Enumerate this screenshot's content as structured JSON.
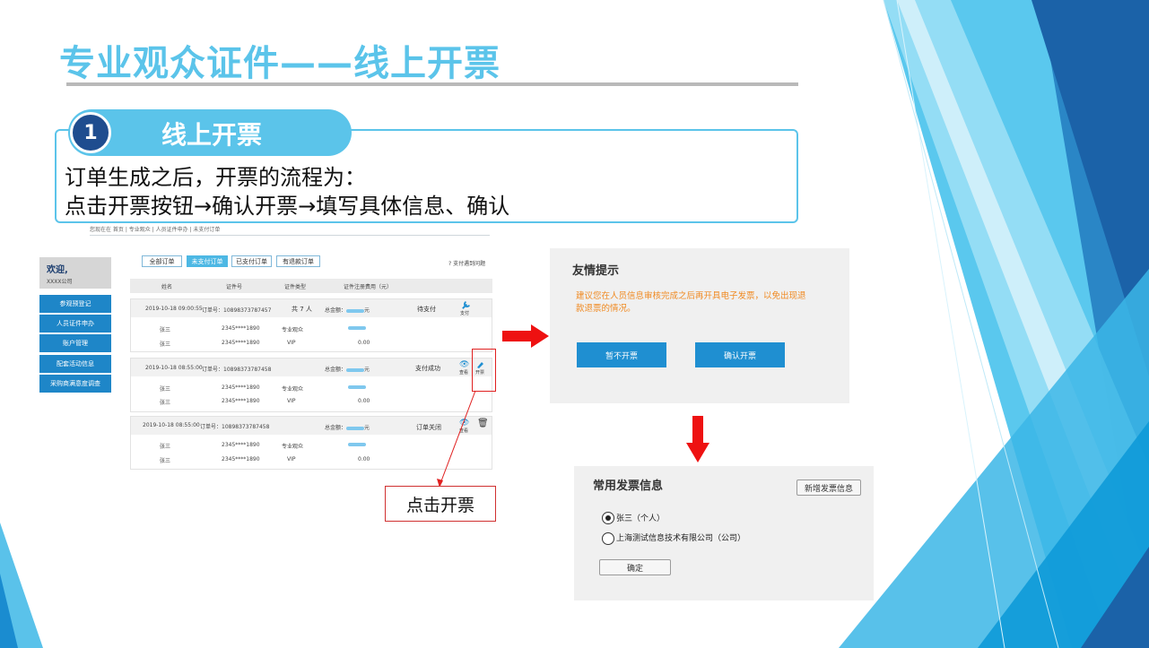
{
  "slide": {
    "title": "专业观众证件——线上开票",
    "step_number": "1",
    "step_label": "线上开票",
    "line1": "订单生成之后，开票的流程为：",
    "line2": "点击开票按钮→确认开票→填写具体信息、确认",
    "callout": "点击开票"
  },
  "portal": {
    "breadcrumb": "您现在在 首页 | 专业观众 | 人员证件申办 | 未支付订单",
    "welcome": "欢迎,",
    "company": "XXXX公司",
    "sidebar": [
      "参观预登记",
      "人员证件申办",
      "账户管理",
      "配套活动信息",
      "采购商满意度调查"
    ],
    "tabs": [
      "全部订单",
      "未支付订单",
      "已支付订单",
      "有退款订单"
    ],
    "help": "? 支付遇到问题",
    "columns": [
      "姓名",
      "证件号",
      "证件类型",
      "证件注册费用（元）"
    ],
    "orders": [
      {
        "date": "2019-10-18 09:00:55",
        "order_no": "订单号：10898373787457",
        "count": "共 7 人",
        "total_label": "总金额：",
        "total_unit": "元",
        "status": "待支付",
        "action": "支付",
        "rows": [
          {
            "name": "张三",
            "id": "2345****1890",
            "type": "专业观众",
            "fee": ""
          },
          {
            "name": "张三",
            "id": "2345****1890",
            "type": "VIP",
            "fee": "0.00"
          }
        ]
      },
      {
        "date": "2019-10-18 08:55:00",
        "order_no": "订单号：10898373787458",
        "count": "",
        "total_label": "总金额：",
        "total_unit": "元",
        "status": "支付成功",
        "action_view": "查看",
        "action_invoice": "开票",
        "rows": [
          {
            "name": "张三",
            "id": "2345****1890",
            "type": "专业观众",
            "fee": ""
          },
          {
            "name": "张三",
            "id": "2345****1890",
            "type": "VIP",
            "fee": "0.00"
          }
        ]
      },
      {
        "date": "2019-10-18 08:55:00",
        "order_no": "订单号：10898373787458",
        "count": "",
        "total_label": "总金额：",
        "total_unit": "元",
        "status": "订单关闭",
        "action_view": "查看",
        "rows": [
          {
            "name": "张三",
            "id": "2345****1890",
            "type": "专业观众",
            "fee": ""
          },
          {
            "name": "张三",
            "id": "2345****1890",
            "type": "VIP",
            "fee": "0.00"
          }
        ]
      }
    ]
  },
  "dialog_notice": {
    "title": "友情提示",
    "message": "建议您在人员信息审核完成之后再开具电子发票，以免出现退款退票的情况。",
    "cancel": "暂不开票",
    "confirm": "确认开票"
  },
  "dialog_invoice": {
    "title": "常用发票信息",
    "add_button": "新增发票信息",
    "options": [
      {
        "label": "张三（个人）",
        "selected": true
      },
      {
        "label": "上海测试信息技术有限公司（公司）",
        "selected": false
      }
    ],
    "confirm": "确定"
  },
  "colors": {
    "accent": "#5bc4ea",
    "dark_blue": "#1f4d8f",
    "button_blue": "#1f8fd1",
    "arrow_red": "#ee1111",
    "notice_orange": "#f08a22"
  }
}
